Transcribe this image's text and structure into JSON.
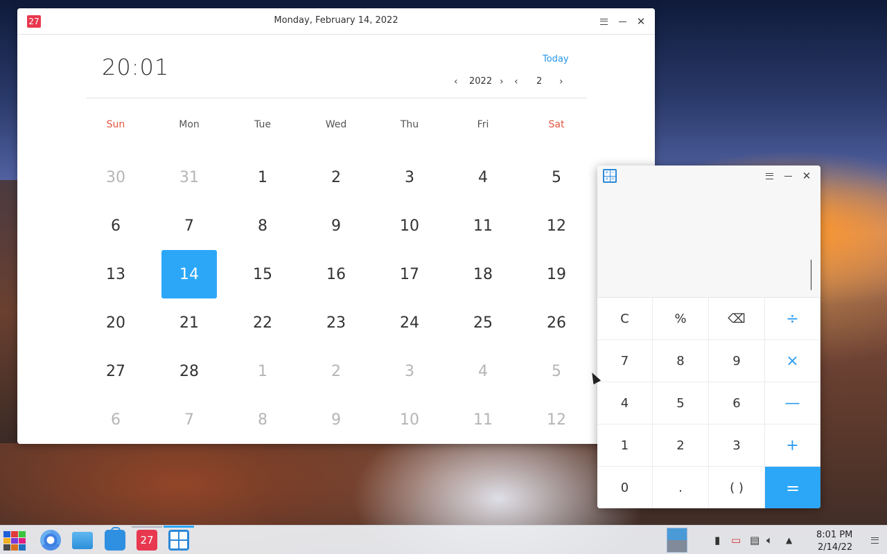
{
  "calendar": {
    "app_icon": "27",
    "title": "Monday, February 14, 2022",
    "time": "20:01",
    "today_label": "Today",
    "year": "2022",
    "month": "2",
    "weekdays": [
      "Sun",
      "Mon",
      "Tue",
      "Wed",
      "Thu",
      "Fri",
      "Sat"
    ],
    "weekend_color": "#e2553e",
    "accent_color": "#2ca7f8",
    "weeks": [
      [
        "30",
        "31",
        "1",
        "2",
        "3",
        "4",
        "5"
      ],
      [
        "6",
        "7",
        "8",
        "9",
        "10",
        "11",
        "12"
      ],
      [
        "13",
        "14",
        "15",
        "16",
        "17",
        "18",
        "19"
      ],
      [
        "20",
        "21",
        "22",
        "23",
        "24",
        "25",
        "26"
      ],
      [
        "27",
        "28",
        "1",
        "2",
        "3",
        "4",
        "5"
      ],
      [
        "6",
        "7",
        "8",
        "9",
        "10",
        "11",
        "12"
      ]
    ],
    "selected_day": "14"
  },
  "calculator": {
    "keys": [
      [
        "C",
        "%",
        "⌫",
        "÷"
      ],
      [
        "7",
        "8",
        "9",
        "×"
      ],
      [
        "4",
        "5",
        "6",
        "—"
      ],
      [
        "1",
        "2",
        "3",
        "+"
      ],
      [
        "0",
        ".",
        "( )",
        "="
      ]
    ],
    "accent_color": "#2ca7f8"
  },
  "taskbar": {
    "apps": [
      "launcher-icon",
      "chrome-icon",
      "file-manager-icon",
      "app-store-icon",
      "calendar-icon",
      "calculator-icon"
    ],
    "calendar_icon_label": "27",
    "clock_time": "8:01 PM",
    "clock_date": "2/14/22"
  }
}
